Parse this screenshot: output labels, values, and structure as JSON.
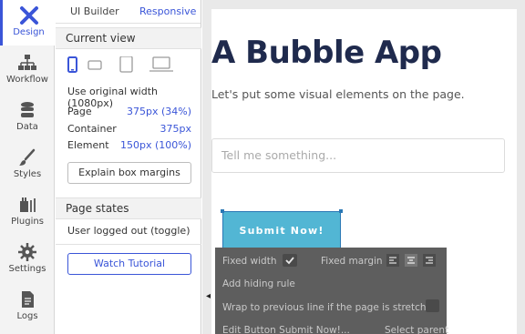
{
  "nav": {
    "items": [
      {
        "label": "Design",
        "icon": "design-icon"
      },
      {
        "label": "Workflow",
        "icon": "workflow-icon"
      },
      {
        "label": "Data",
        "icon": "data-icon"
      },
      {
        "label": "Styles",
        "icon": "styles-icon"
      },
      {
        "label": "Plugins",
        "icon": "plugins-icon"
      },
      {
        "label": "Settings",
        "icon": "settings-icon"
      },
      {
        "label": "Logs",
        "icon": "logs-icon"
      }
    ]
  },
  "panel": {
    "tabs": {
      "ui_builder": "UI Builder",
      "responsive": "Responsive"
    },
    "current_view": "Current view",
    "use_original_width": "Use original width (1080px)",
    "rows": [
      {
        "label": "Page",
        "value": "375px (34%)"
      },
      {
        "label": "Container",
        "value": "375px"
      },
      {
        "label": "Element",
        "value": "150px (100%)"
      }
    ],
    "explain_btn": "Explain box margins",
    "page_states": "Page states",
    "user_logged_out": "User logged out (toggle)",
    "watch_tutorial": "Watch Tutorial"
  },
  "canvas": {
    "title": "A Bubble App",
    "subtitle": "Let's put some visual elements on the page.",
    "input_placeholder": "Tell me something...",
    "submit_label": "Submit Now!"
  },
  "context_menu": {
    "fixed_width": "Fixed width",
    "fixed_margin": "Fixed margin",
    "add_hiding_rule": "Add hiding rule",
    "wrap_label": "Wrap to previous line if the page is stretched",
    "edit_label": "Edit Button Submit Now!...",
    "select_parent": "Select parent"
  },
  "colors": {
    "accent": "#3a55d8",
    "button": "#52b6d4",
    "title": "#1f2a4d"
  }
}
